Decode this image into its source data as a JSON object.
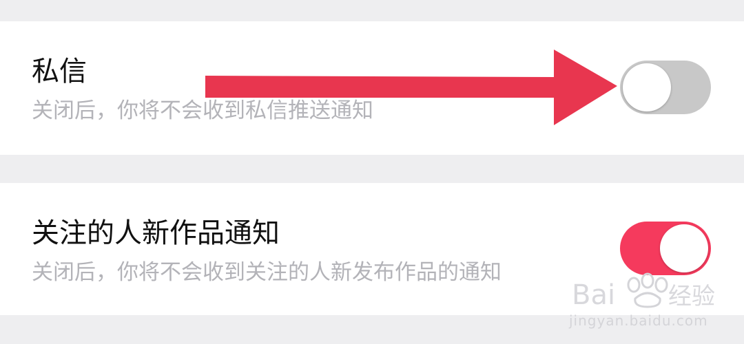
{
  "colors": {
    "background": "#eeeef0",
    "card": "#ffffff",
    "toggle_on": "#f53a5d",
    "toggle_off": "#c8c8c8",
    "arrow": "#e8364f"
  },
  "settings": [
    {
      "title": "私信",
      "description": "关闭后，你将不会收到私信推送通知",
      "enabled": false
    },
    {
      "title": "关注的人新作品通知",
      "description": "关闭后，你将不会收到关注的人新发布作品的通知",
      "enabled": true
    }
  ],
  "watermark": {
    "brand": "Baidu经验",
    "url": "jingyan.baidu.com"
  }
}
